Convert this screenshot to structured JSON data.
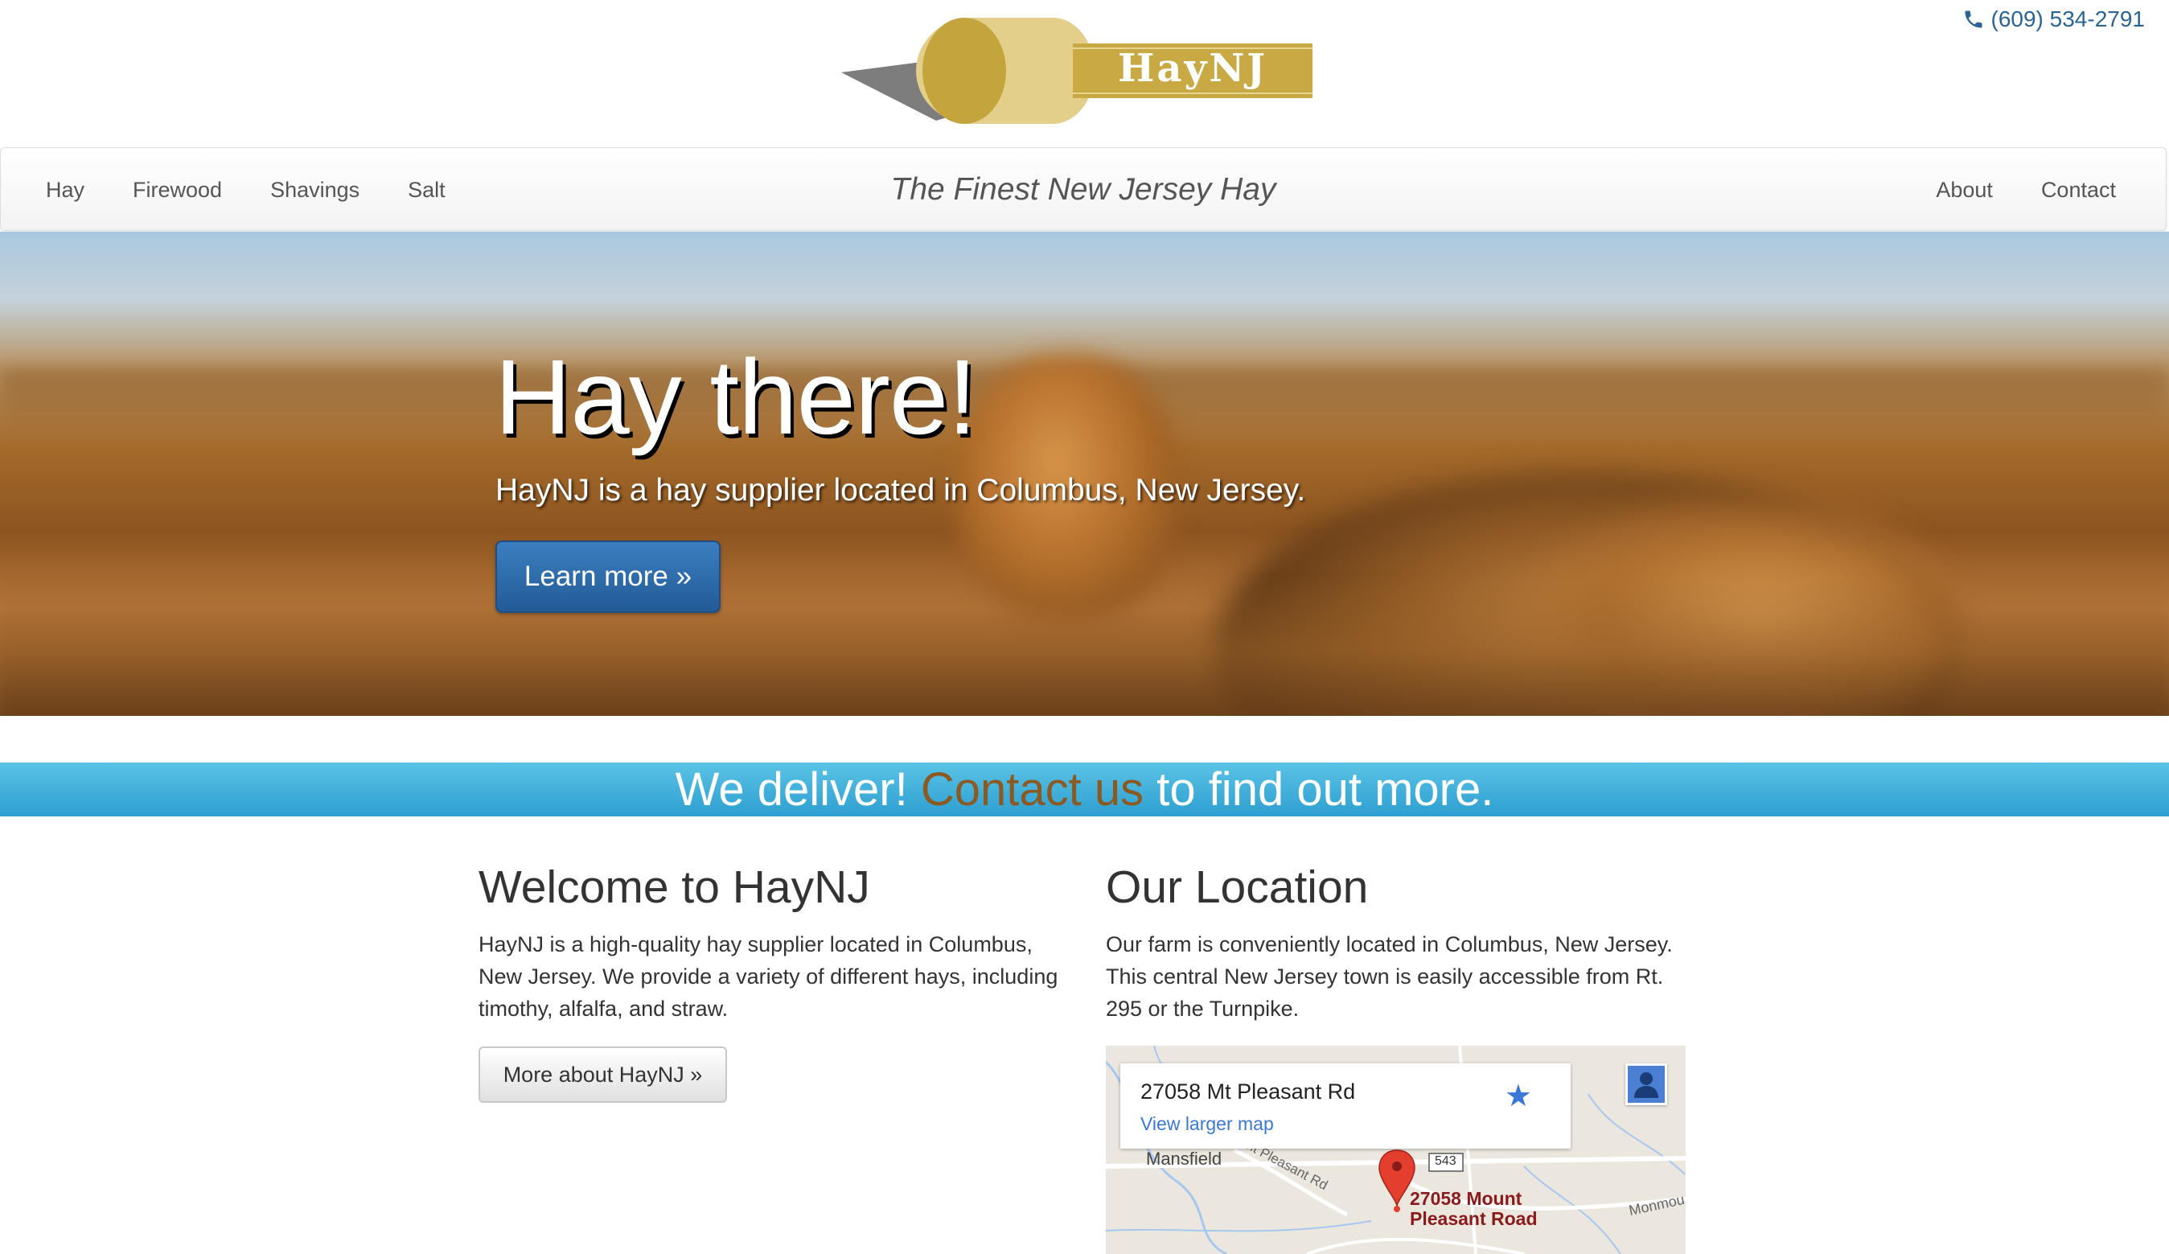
{
  "header": {
    "brand": "HayNJ",
    "phone": "(609) 534-2791",
    "phone_icon": "phone-icon",
    "logo_color": "#c8a944"
  },
  "nav": {
    "left_items": [
      "Hay",
      "Firewood",
      "Shavings",
      "Salt"
    ],
    "tagline": "The Finest New Jersey Hay",
    "right_items": [
      "About",
      "Contact"
    ]
  },
  "hero": {
    "title": "Hay there!",
    "subtitle": "HayNJ is a hay supplier located in Columbus, New Jersey.",
    "button": "Learn more »"
  },
  "banner": {
    "before": "We deliver! ",
    "link": "Contact us",
    "after": " to find out more.",
    "color": "#42b3df",
    "link_color": "#8a5a22"
  },
  "welcome": {
    "title": "Welcome to HayNJ",
    "body": "HayNJ is a high-quality hay supplier located in Columbus, New Jersey. We provide a variety of different hays, including timothy, alfalfa, and straw.",
    "button": "More about HayNJ »"
  },
  "location": {
    "title": "Our Location",
    "body": "Our farm is conveniently located in Columbus, New Jersey. This central New Jersey town is easily accessible from Rt. 295 or the Turnpike.",
    "map": {
      "card_address": "27058 Mt Pleasant Rd",
      "card_link": "View larger map",
      "town": "Mansfield",
      "road": "Mt Pleasant Rd",
      "route": "543",
      "pin_line1": "27058 Mount",
      "pin_line2": "Pleasant Road",
      "edge_label": "Monmou"
    }
  }
}
